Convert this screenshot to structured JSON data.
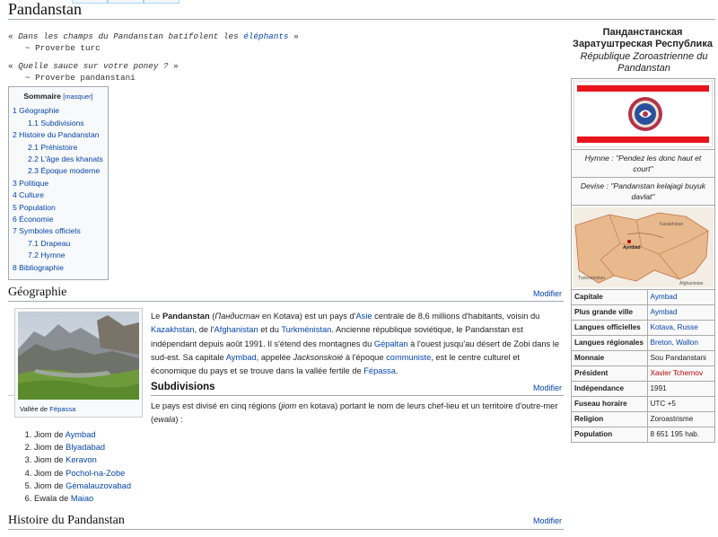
{
  "page": {
    "title": "Pandanstan"
  },
  "quotes": [
    {
      "open": "«",
      "text_a": "Dans les champs du Pandanstan batifolent les",
      "link": "éléphants",
      "close": "»",
      "source": "~ Proverbe turc"
    },
    {
      "open": "«",
      "text_a": "Quelle sauce sur votre poney ?",
      "link": "",
      "close": "»",
      "source": "~ Proverbe pandanstani"
    }
  ],
  "toc": {
    "title": "Sommaire",
    "toggle": "[masquer]",
    "items": [
      {
        "num": "1",
        "label": "Géographie",
        "level": 1
      },
      {
        "num": "1.1",
        "label": "Subdivisions",
        "level": 2
      },
      {
        "num": "2",
        "label": "Histoire du Pandanstan",
        "level": 1
      },
      {
        "num": "2.1",
        "label": "Préhistoire",
        "level": 2
      },
      {
        "num": "2.2",
        "label": "L'âge des khanats",
        "level": 2
      },
      {
        "num": "2.3",
        "label": "Époque moderne",
        "level": 2
      },
      {
        "num": "3",
        "label": "Politique",
        "level": 1
      },
      {
        "num": "4",
        "label": "Culture",
        "level": 1
      },
      {
        "num": "5",
        "label": "Population",
        "level": 1
      },
      {
        "num": "6",
        "label": "Économie",
        "level": 1
      },
      {
        "num": "7",
        "label": "Symboles officiels",
        "level": 1
      },
      {
        "num": "7.1",
        "label": "Drapeau",
        "level": 2
      },
      {
        "num": "7.2",
        "label": "Hymne",
        "level": 2
      },
      {
        "num": "8",
        "label": "Bibliographie",
        "level": 1
      }
    ]
  },
  "geo": {
    "heading": "Géographie",
    "edit": "Modifier",
    "thumb_caption_a": "Vallée de",
    "thumb_caption_link": "Fépassa",
    "para": [
      {
        "t": "Le "
      },
      {
        "b": "Pandanstan"
      },
      {
        "t": " ("
      },
      {
        "i": "Пандистан"
      },
      {
        "t": " en Kotava) est un pays d'"
      },
      {
        "a": "Asie"
      },
      {
        "t": " centrale de 8,6 millions d'habitants, voisin du "
      },
      {
        "a": "Kazakhstan"
      },
      {
        "t": ", de l'"
      },
      {
        "a": "Afghanistan"
      },
      {
        "t": " et du "
      },
      {
        "a": "Turkménistan"
      },
      {
        "t": ". Ancienne république soviétique, le Pandanstan est indépendant depuis août 1991. Il s'étend des montagnes du "
      },
      {
        "a": "Gépaltan"
      },
      {
        "t": " à l'ouest jusqu'au désert de Zobi dans le sud-est. Sa capitale "
      },
      {
        "a": "Aymbad"
      },
      {
        "t": ", appelée "
      },
      {
        "i": "Jacksonskoié"
      },
      {
        "t": " à l'époque "
      },
      {
        "a": "communiste"
      },
      {
        "t": ", est le centre culturel et économique du pays et se trouve dans la vallée fertile de "
      },
      {
        "a": "Fépassa"
      },
      {
        "t": "."
      }
    ]
  },
  "subdiv": {
    "heading": "Subdivisions",
    "edit": "Modifier",
    "para": [
      {
        "t": "Le pays est divisé en cinq régions ("
      },
      {
        "i": "jiom"
      },
      {
        "t": " en kotava) portant le nom de leurs chef-lieu et un territoire d'outre-mer ("
      },
      {
        "i": "ewala"
      },
      {
        "t": ") :"
      }
    ],
    "list": [
      {
        "pre": "Jiom de ",
        "link": "Aymbad"
      },
      {
        "pre": "Jiom de ",
        "link": "Blyadabad"
      },
      {
        "pre": "Jiom de ",
        "link": "Keravon"
      },
      {
        "pre": "Jiom de ",
        "link": "Pochol-na-Zobe"
      },
      {
        "pre": "Jiom de ",
        "link": "Gémalauzovabad"
      },
      {
        "pre": "Ewala de ",
        "link": "Maiao"
      }
    ]
  },
  "hist": {
    "heading": "Histoire du Pandanstan",
    "edit": "Modifier"
  },
  "infobox": {
    "title": "Панданстанская Заратуштреская Республика",
    "subtitle": "République Zoroastrienne du Pandanstan",
    "hymne": "Hymne : \"Pendez les donc haut et court\"",
    "devise": "Devise : \"Pandanstan kelajagi buyuk davlat\"",
    "map_labels": [
      "Kazakhstan",
      "Turkménistan",
      "Aymbad",
      "Afghanistan"
    ],
    "rows": [
      {
        "k": "Capitale",
        "v": "Aymbad",
        "style": "link"
      },
      {
        "k": "Plus grande ville",
        "v": "Aymbad",
        "style": "link"
      },
      {
        "k": "Langues officielles",
        "v": "Kotava, Russe",
        "style": "link"
      },
      {
        "k": "Langues régionales",
        "v": "Breton, Wallon",
        "style": "link"
      },
      {
        "k": "Monnaie",
        "v": "Sou Pandanstani",
        "style": "text"
      },
      {
        "k": "Président",
        "v": "Xavier Tchernov",
        "style": "red"
      },
      {
        "k": "Indépendance",
        "v": "1991",
        "style": "text"
      },
      {
        "k": "Fuseau horaire",
        "v": "UTC +5",
        "style": "text"
      },
      {
        "k": "Religion",
        "v": "Zoroastrisme",
        "style": "text"
      },
      {
        "k": "Population",
        "v": "8 651 195 hab.",
        "style": "text"
      }
    ]
  },
  "colors": {
    "link": "#0645ad",
    "redlink": "#ba0000",
    "flag_red": "#e8141b",
    "emblem": "#2a4f9c"
  }
}
